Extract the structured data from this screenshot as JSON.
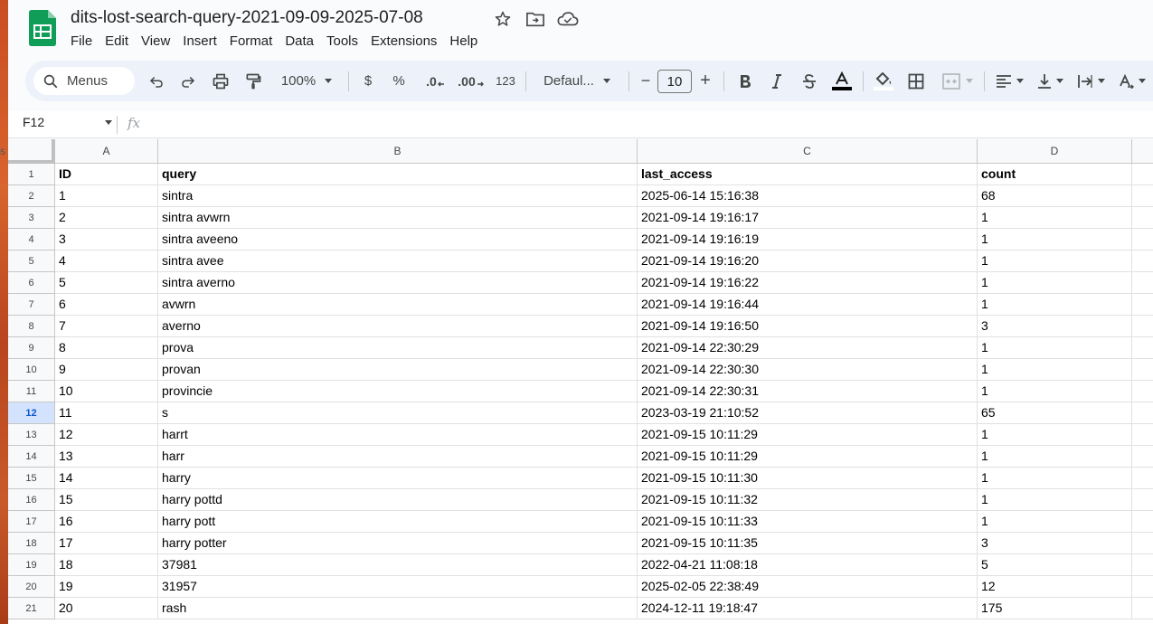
{
  "app": {
    "doc_title": "dits-lost-search-query-2021-09-09-2025-07-08",
    "menus": [
      "File",
      "Edit",
      "View",
      "Insert",
      "Format",
      "Data",
      "Tools",
      "Extensions",
      "Help"
    ]
  },
  "toolbar": {
    "search_label": "Menus",
    "zoom": "100%",
    "currency": "$",
    "percent": "%",
    "dec_decrease": ".0",
    "dec_increase": ".00",
    "number_format": "123",
    "font": "Defaul...",
    "minus": "−",
    "font_size": "10",
    "plus": "+"
  },
  "formula_bar": {
    "cell_ref": "F12",
    "fx": "fx"
  },
  "sheet": {
    "columns": [
      "A",
      "B",
      "C",
      "D"
    ],
    "selected_row": 12,
    "rows": [
      {
        "num": "1",
        "cells": [
          "ID",
          "query",
          "last_access",
          "count"
        ]
      },
      {
        "num": "2",
        "cells": [
          "1",
          "sintra",
          "2025-06-14 15:16:38",
          "68"
        ]
      },
      {
        "num": "3",
        "cells": [
          "2",
          "sintra avwrn",
          "2021-09-14 19:16:17",
          "1"
        ]
      },
      {
        "num": "4",
        "cells": [
          "3",
          "sintra aveeno",
          "2021-09-14 19:16:19",
          "1"
        ]
      },
      {
        "num": "5",
        "cells": [
          "4",
          "sintra avee",
          "2021-09-14 19:16:20",
          "1"
        ]
      },
      {
        "num": "6",
        "cells": [
          "5",
          "sintra averno",
          "2021-09-14 19:16:22",
          "1"
        ]
      },
      {
        "num": "7",
        "cells": [
          "6",
          "avwrn",
          "2021-09-14 19:16:44",
          "1"
        ]
      },
      {
        "num": "8",
        "cells": [
          "7",
          "averno",
          "2021-09-14 19:16:50",
          "3"
        ]
      },
      {
        "num": "9",
        "cells": [
          "8",
          "prova",
          "2021-09-14 22:30:29",
          "1"
        ]
      },
      {
        "num": "10",
        "cells": [
          "9",
          "provan",
          "2021-09-14 22:30:30",
          "1"
        ]
      },
      {
        "num": "11",
        "cells": [
          "10",
          "provincie",
          "2021-09-14 22:30:31",
          "1"
        ]
      },
      {
        "num": "12",
        "cells": [
          "11",
          "s",
          "2023-03-19 21:10:52",
          "65"
        ]
      },
      {
        "num": "13",
        "cells": [
          "12",
          "harrt",
          "2021-09-15 10:11:29",
          "1"
        ]
      },
      {
        "num": "14",
        "cells": [
          "13",
          "harr",
          "2021-09-15 10:11:29",
          "1"
        ]
      },
      {
        "num": "15",
        "cells": [
          "14",
          "harry",
          "2021-09-15 10:11:30",
          "1"
        ]
      },
      {
        "num": "16",
        "cells": [
          "15",
          "harry pottd",
          "2021-09-15 10:11:32",
          "1"
        ]
      },
      {
        "num": "17",
        "cells": [
          "16",
          "harry pott",
          "2021-09-15 10:11:33",
          "1"
        ]
      },
      {
        "num": "18",
        "cells": [
          "17",
          "harry potter",
          "2021-09-15 10:11:35",
          "3"
        ]
      },
      {
        "num": "19",
        "cells": [
          "18",
          "37981",
          "2022-04-21 11:08:18",
          "5"
        ]
      },
      {
        "num": "20",
        "cells": [
          "19",
          "31957",
          "2025-02-05 22:38:49",
          "12"
        ]
      },
      {
        "num": "21",
        "cells": [
          "20",
          "rash",
          "2024-12-11 19:18:47",
          "175"
        ]
      }
    ]
  },
  "colors": {
    "accent_green": "#0f9d58",
    "selected_blue": "#0b57d0"
  }
}
